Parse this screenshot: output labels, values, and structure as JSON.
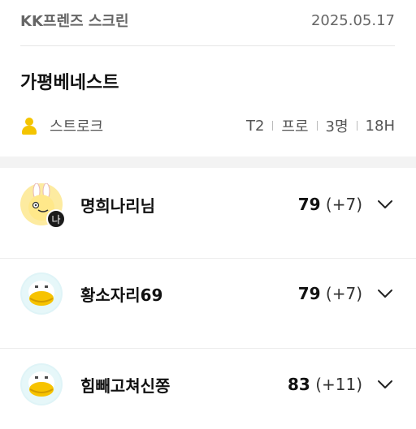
{
  "header": {
    "venue": "KK프렌즈 스크린",
    "date": "2025.05.17"
  },
  "course": {
    "name": "가평베네스트"
  },
  "game": {
    "mode": "스트로크",
    "tee": "T2",
    "level": "프로",
    "players": "3명",
    "holes": "18H"
  },
  "players": [
    {
      "name": "명희나리님",
      "score": "79",
      "diff": "(+7)",
      "badge": "나",
      "avatar": "rabbit-avatar"
    },
    {
      "name": "황소자리69",
      "score": "79",
      "diff": "(+7)",
      "badge": "",
      "avatar": "duck-avatar"
    },
    {
      "name": "힘빼고쳐신쫑",
      "score": "83",
      "diff": "(+11)",
      "badge": "",
      "avatar": "duck-avatar"
    }
  ]
}
